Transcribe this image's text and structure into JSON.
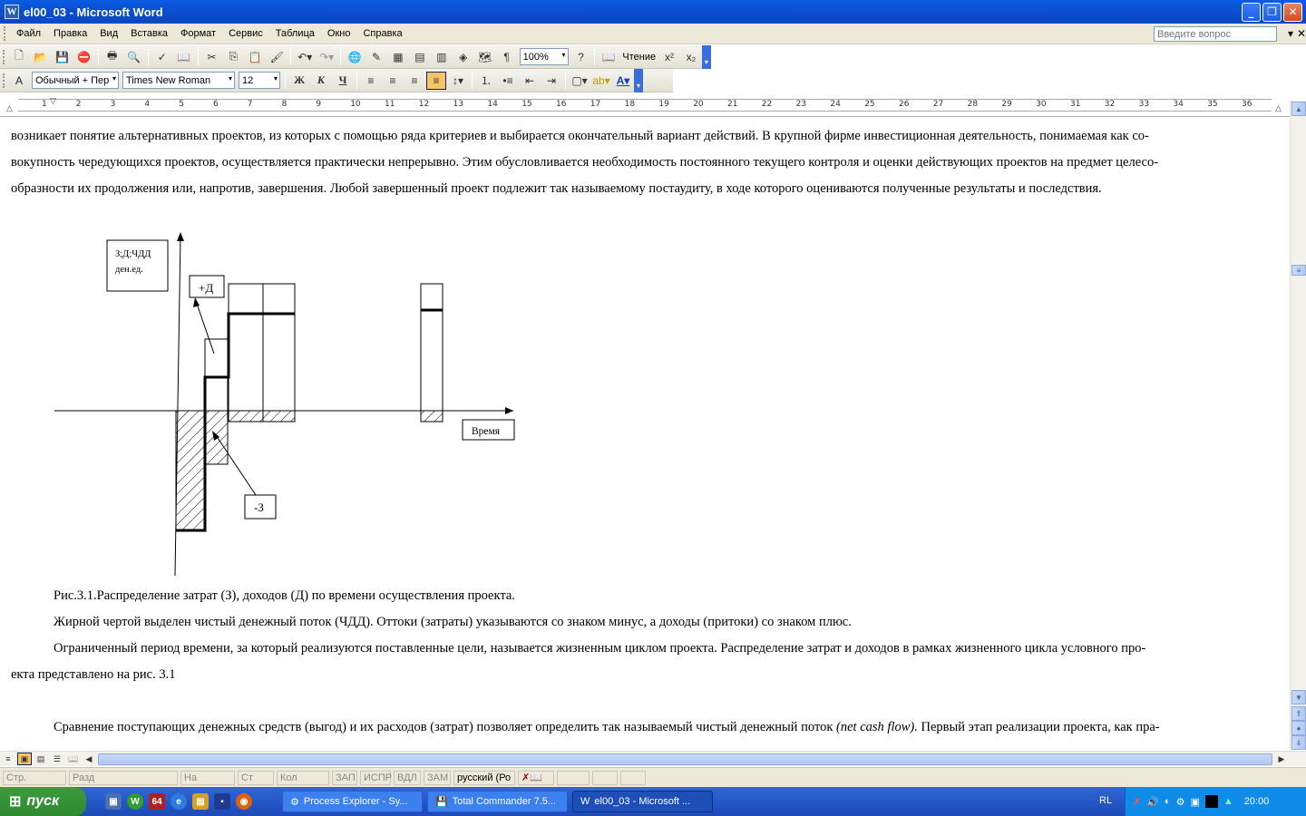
{
  "window": {
    "title": "el00_03 - Microsoft Word",
    "icon": "W"
  },
  "menu": {
    "items": [
      "Файл",
      "Правка",
      "Вид",
      "Вставка",
      "Формат",
      "Сервис",
      "Таблица",
      "Окно",
      "Справка"
    ],
    "ask_placeholder": "Введите вопрос"
  },
  "toolbar1": {
    "zoom": "100%",
    "reading": "Чтение"
  },
  "toolbar2": {
    "style": "Обычный + Пер",
    "font": "Times New Roman",
    "size": "12",
    "bold": "Ж",
    "italic": "К",
    "underline": "Ч"
  },
  "ruler": {
    "ticks": [
      "1",
      "2",
      "3",
      "4",
      "5",
      "6",
      "7",
      "8",
      "9",
      "10",
      "11",
      "12",
      "13",
      "14",
      "15",
      "16",
      "17",
      "18",
      "19",
      "20",
      "21",
      "22",
      "23",
      "24",
      "25",
      "26",
      "27",
      "28",
      "29",
      "30",
      "31",
      "32",
      "33",
      "34",
      "35",
      "36"
    ]
  },
  "document": {
    "p1": "возникает понятие альтернативных проектов, из которых с помощью ряда критериев и выбирается окончательный вариант действий. В крупной фирме инвестиционная деятельность, понимаемая как со-",
    "p2": "вокупность чередующихся проектов, осуществляется практически непрерывно. Этим обусловливается необходимость постоянного текущего контроля и оценки действующих проектов на предмет целесо-",
    "p3": "образности их продолжения или, напротив, завершения. Любой завершенный проект подлежит так называемому постаудиту, в ходе которого оцениваются полученные результаты и последствия.",
    "caption": "Рис.3.1.Распределение затрат (З), доходов (Д) по времени осуществления проекта.",
    "p4": "Жирной чертой выделен чистый денежный поток (ЧДД). Оттоки (затраты) указываются со знаком минус, а доходы (притоки) со знаком плюс.",
    "p5": "Ограниченный период времени, за который реализуются поставленные цели, называется жизненным циклом проекта. Распределение затрат и доходов в рамках жизненного цикла условного про-",
    "p6": "екта представлено на рис. 3.1",
    "p7": "Сравнение поступающих денежных средств (выгод) и их расходов (затрат) позволяет определить так называемый чистый денежный поток",
    "p7_italic": "(net cash flow).",
    "p7_tail": " Первый этап реализации проекта, как пра-"
  },
  "figure": {
    "ylabel_line1": "З;Д;ЧДД",
    "ylabel_line2": "ден.ед.",
    "plus_label": "+Д",
    "minus_label": "-З",
    "xlabel": "Время"
  },
  "status": {
    "page": "Стр.",
    "section": "Разд",
    "at": "На",
    "line": "Ст",
    "col": "Кол",
    "rec": "ЗАП",
    "trk": "ИСПР",
    "ext": "ВДЛ",
    "ovr": "ЗАМ",
    "lang": "русский (Ро"
  },
  "taskbar": {
    "start": "пуск",
    "tasks": [
      "Process Explorer - Sy...",
      "Total Commander 7.5...",
      "el00_03 - Microsoft ..."
    ],
    "lang": "RL",
    "clock": "20:00"
  }
}
